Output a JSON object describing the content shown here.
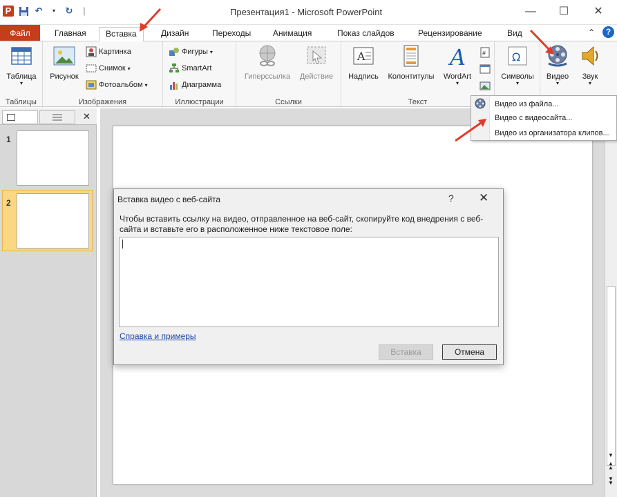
{
  "window": {
    "title": "Презентация1 - Microsoft PowerPoint",
    "minimize": "—",
    "maximize": "☐",
    "close": "✕"
  },
  "qat": {
    "separator": "|"
  },
  "tabs": [
    {
      "label": "Файл"
    },
    {
      "label": "Главная"
    },
    {
      "label": "Вставка"
    },
    {
      "label": "Дизайн"
    },
    {
      "label": "Переходы"
    },
    {
      "label": "Анимация"
    },
    {
      "label": "Показ слайдов"
    },
    {
      "label": "Рецензирование"
    },
    {
      "label": "Вид"
    }
  ],
  "ribbon": {
    "tables": {
      "group": "Таблицы",
      "table": "Таблица"
    },
    "images": {
      "group": "Изображения",
      "picture": "Рисунок",
      "clipart": "Картинка",
      "screenshot": "Снимок",
      "album": "Фотоальбом"
    },
    "illustrations": {
      "group": "Иллюстрации",
      "shapes": "Фигуры",
      "smartart": "SmartArt",
      "chart": "Диаграмма"
    },
    "links": {
      "group": "Ссылки",
      "hyperlink": "Гиперссылка",
      "action": "Действие"
    },
    "text": {
      "group": "Текст",
      "textbox": "Надпись",
      "headers": "Колонтитулы",
      "wordart": "WordArt"
    },
    "symbols": {
      "label": "Символы"
    },
    "video": {
      "label": "Видео"
    },
    "audio": {
      "label": "Звук"
    }
  },
  "dropdown": {
    "items": [
      {
        "label": "Видео из файла..."
      },
      {
        "label": "Видео с видеосайта..."
      },
      {
        "label": "Видео из организатора клипов..."
      }
    ]
  },
  "slides_panel": {
    "slides": [
      {
        "num": "1"
      },
      {
        "num": "2"
      }
    ],
    "close": "✕"
  },
  "dialog": {
    "title": "Вставка видео с веб-сайта",
    "help": "?",
    "close": "✕",
    "instruction": "Чтобы вставить ссылку на видео, отправленное на веб-сайт, скопируйте код внедрения с веб-сайта и вставьте его в расположенное ниже текстовое поле:",
    "input_value": "",
    "help_link": "Справка и примеры",
    "insert_button": "Вставка",
    "cancel_button": "Отмена"
  },
  "colors": {
    "accent": "#c43e1c",
    "arrow": "#e03b2b",
    "selected_slide": "#fbd784"
  }
}
